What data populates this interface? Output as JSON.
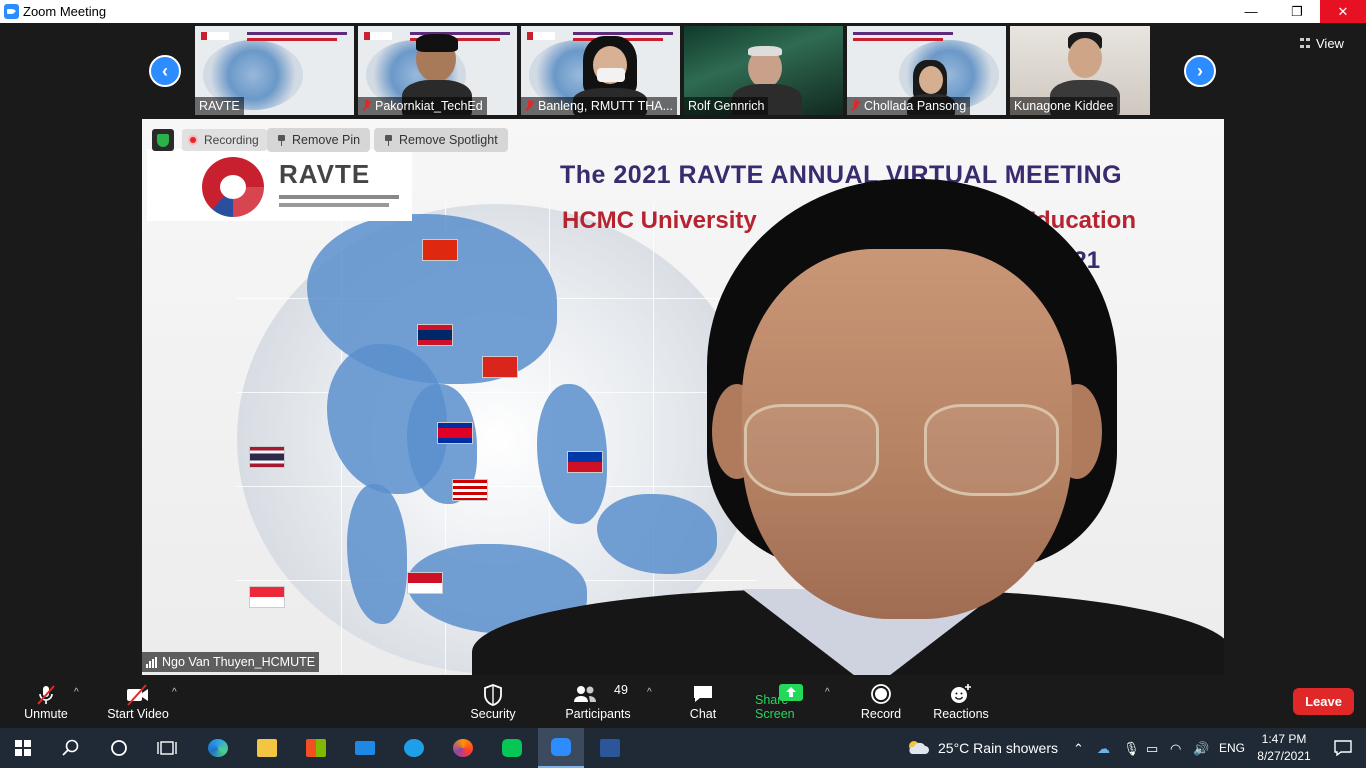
{
  "window": {
    "title": "Zoom Meeting",
    "minimize": "—",
    "restore": "❐",
    "close": "✕"
  },
  "view": {
    "label": "View"
  },
  "gallery": {
    "prev": "‹",
    "next": "›",
    "thumbs": [
      {
        "name": "RAVTE",
        "muted": false
      },
      {
        "name": "Pakornkiat_TechEd",
        "muted": true
      },
      {
        "name": "Banleng, RMUTT THA...",
        "muted": true
      },
      {
        "name": "Rolf Gennrich",
        "muted": false
      },
      {
        "name": "Chollada Pansong",
        "muted": true
      },
      {
        "name": "Kunagone Kiddee",
        "muted": false
      }
    ]
  },
  "spotlight": {
    "recording": "Recording",
    "remove_pin": "Remove Pin",
    "remove_spotlight": "Remove Spotlight",
    "speaker_name": "Ngo Van Thuyen_HCMUTE",
    "slide": {
      "logo": "RAVTE",
      "title": "The 2021 RAVTE ANNUAL VIRTUAL MEETING",
      "subtitle": "HCMC University",
      "subtitle_end": "Education",
      "date_end": "t 2021"
    }
  },
  "toolbar": {
    "unmute": "Unmute",
    "start_video": "Start Video",
    "security": "Security",
    "participants": "Participants",
    "participant_count": "49",
    "chat": "Chat",
    "share_screen": "Share Screen",
    "record": "Record",
    "reactions": "Reactions",
    "leave": "Leave"
  },
  "taskbar": {
    "weather": "25°C  Rain showers",
    "language": "ENG",
    "time": "1:47 PM",
    "date": "8/27/2021"
  },
  "colors": {
    "zoom_blue": "#2d8cff",
    "leave_red": "#e02828",
    "share_green": "#23d959",
    "taskbar": "#1f2a36"
  }
}
